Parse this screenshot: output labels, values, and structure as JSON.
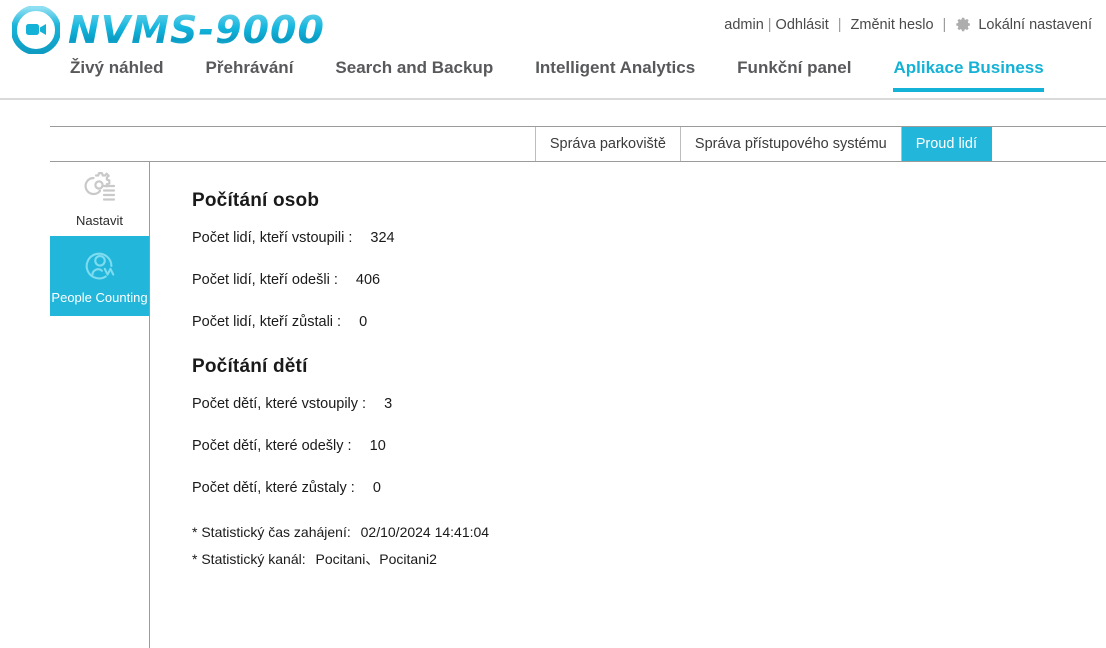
{
  "brand": {
    "logo_icon": "video-camera-circle-icon",
    "name": "NVMS-9000"
  },
  "user_bar": {
    "user": "admin",
    "separator_pipe": "|",
    "logout_label": "Odhlásit",
    "change_password_label": "Změnit heslo",
    "local_settings_label": "Lokální nastavení",
    "gear_icon": "gear-icon"
  },
  "main_nav": {
    "items": [
      {
        "label": "Živý náhled",
        "active": false
      },
      {
        "label": "Přehrávání",
        "active": false
      },
      {
        "label": "Search and Backup",
        "active": false
      },
      {
        "label": "Intelligent Analytics",
        "active": false
      },
      {
        "label": "Funkční panel",
        "active": false
      },
      {
        "label": "Aplikace Business",
        "active": true
      }
    ],
    "accent_color": "#14b2d6"
  },
  "tabs": [
    {
      "label": "Správa parkoviště",
      "active": false
    },
    {
      "label": "Správa přístupového systému",
      "active": false
    },
    {
      "label": "Proud lidí",
      "active": true
    }
  ],
  "sidebar": {
    "items": [
      {
        "label": "Nastavit",
        "icon": "settings-gear-lines-icon",
        "active": false
      },
      {
        "label": "People Counting",
        "icon": "people-counting-icon",
        "active": true
      }
    ],
    "active_color": "#22b6da"
  },
  "content": {
    "people_section": {
      "title": "Počítání osob",
      "rows": [
        {
          "label": "Počet lidí, kteří vstoupili :",
          "value": "324"
        },
        {
          "label": "Počet lidí, kteří odešli :",
          "value": "406"
        },
        {
          "label": "Počet lidí, kteří zůstali :",
          "value": "0"
        }
      ]
    },
    "children_section": {
      "title": "Počítání dětí",
      "rows": [
        {
          "label": "Počet dětí, které vstoupily :",
          "value": "3"
        },
        {
          "label": "Počet dětí, které odešly :",
          "value": "10"
        },
        {
          "label": "Počet dětí, které zůstaly :",
          "value": "0"
        }
      ]
    },
    "notes": [
      {
        "label": "* Statistický čas zahájení:",
        "value": "02/10/2024 14:41:04"
      },
      {
        "label": "* Statistický kanál:",
        "value": "Pocitani、Pocitani2"
      }
    ]
  }
}
